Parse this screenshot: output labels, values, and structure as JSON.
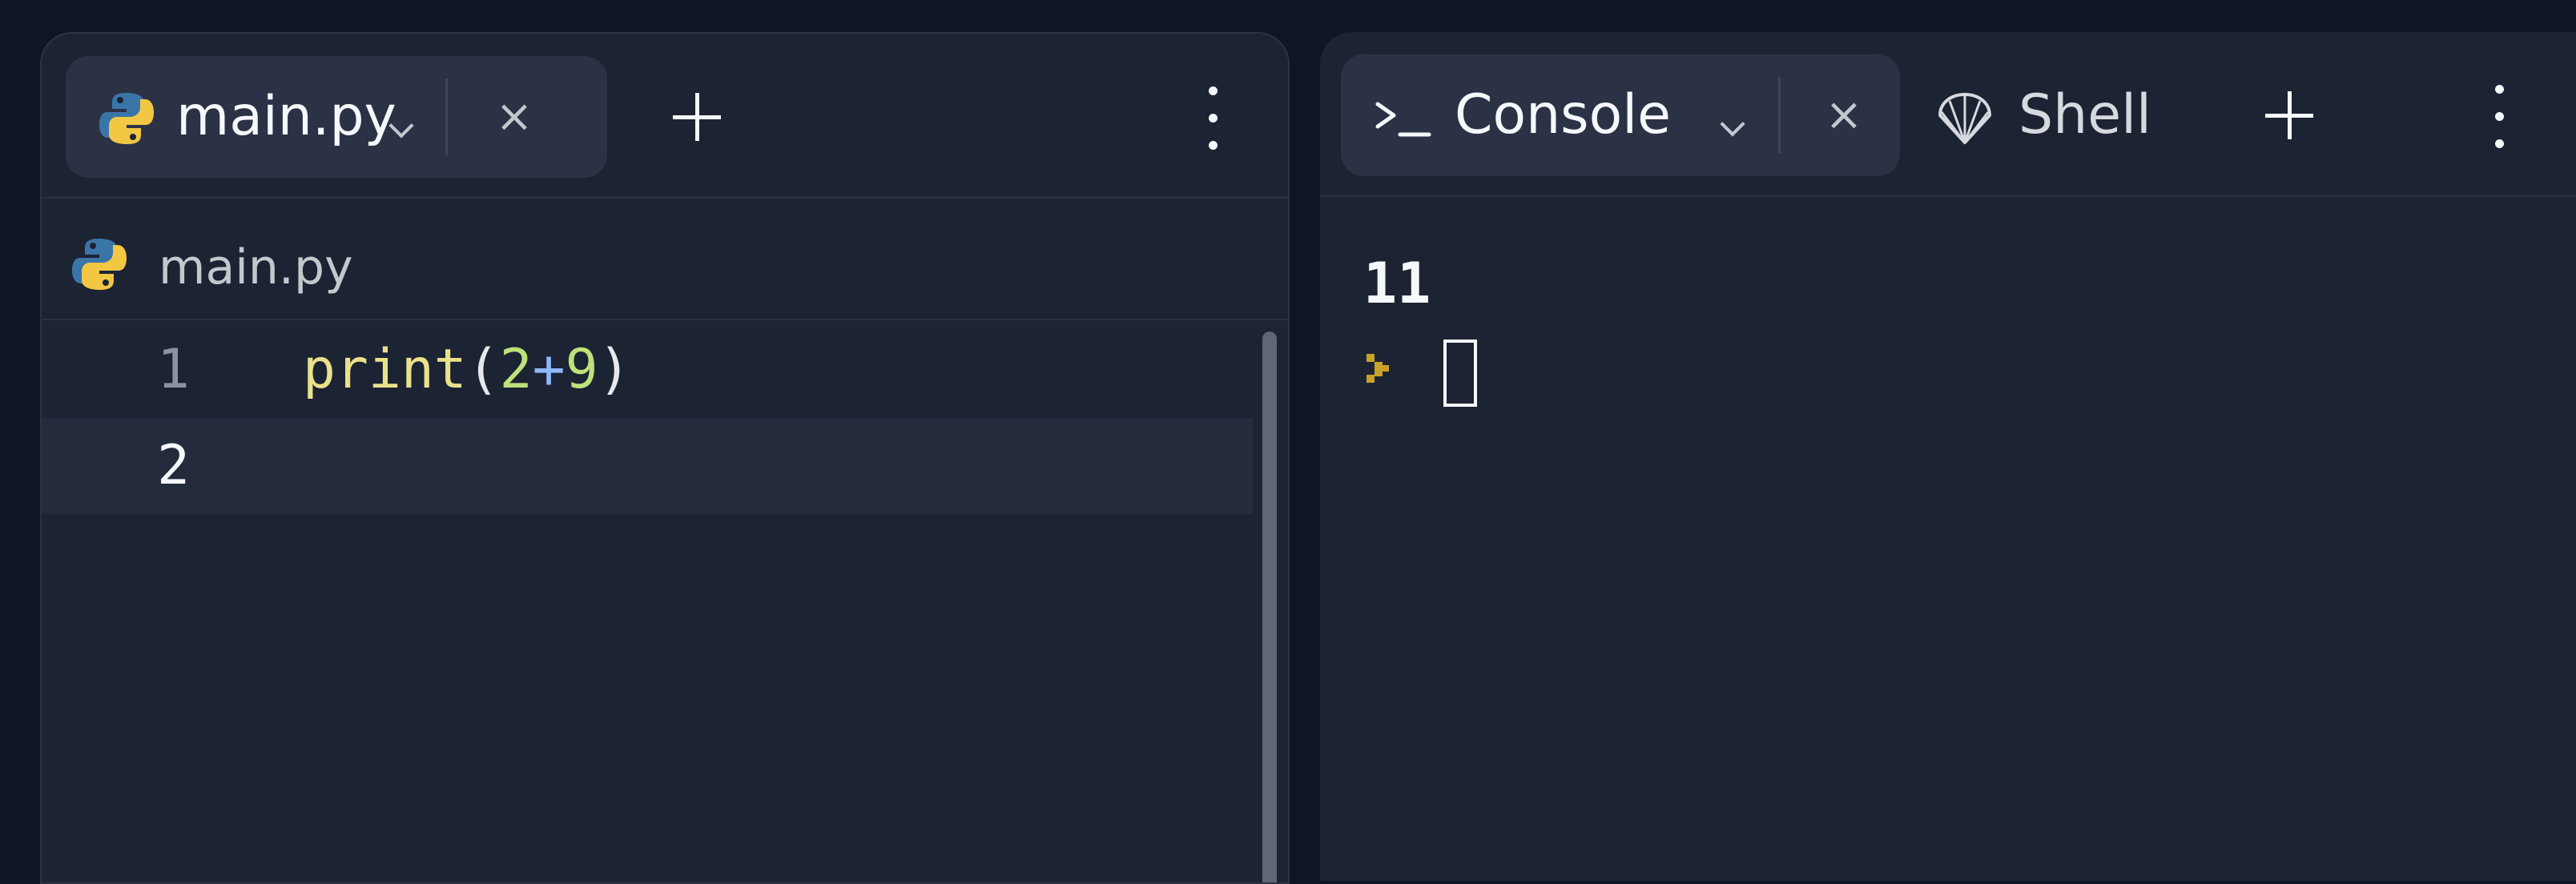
{
  "editor_pane": {
    "tab": {
      "icon": "python-icon",
      "label": "main.py"
    },
    "file_breadcrumb": {
      "icon": "python-icon",
      "label": "main.py"
    },
    "lines": [
      {
        "number": "1",
        "tokens": [
          "print",
          "(",
          "2",
          "+",
          "9",
          ")"
        ]
      },
      {
        "number": "2",
        "tokens": []
      }
    ]
  },
  "console_pane": {
    "tabs": [
      {
        "icon": "terminal-prompt-icon",
        "label": "Console",
        "active": true
      },
      {
        "icon": "shell-icon",
        "label": "Shell",
        "active": false
      }
    ],
    "output": [
      "11"
    ]
  },
  "colors": {
    "background": "#0e1525",
    "pane": "#1c2333",
    "tab_active": "#2b3245",
    "text": "#f5f9fc",
    "prompt_accent": "#c9a227",
    "python_blue": "#3a75a8",
    "python_yellow": "#f2c744"
  }
}
